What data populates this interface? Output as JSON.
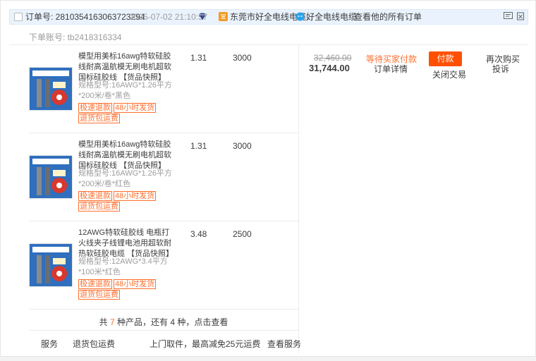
{
  "header": {
    "order_label": "订单号: 2810354163063723294",
    "order_date": "2025-07-02 21:10:57",
    "shop_name": "东莞市好全电线电缆...",
    "wangwang_name": "好全电线电缆",
    "view_all": "查看他的所有订单"
  },
  "sub_account": {
    "label": "下单账号:",
    "value": "tb2418316334"
  },
  "items": [
    {
      "title": "模型用美标16awg特软硅胶线耐高温航模无刷电机超软国标硅胶线 【货品快照】",
      "spec": "规格型号:16AWG*1.26平方*200米/卷*黑色",
      "tags": [
        "极速退款",
        "48小时发货",
        "退货包运费"
      ],
      "price": "1.31",
      "qty": "3000"
    },
    {
      "title": "模型用美标16awg特软硅胶线耐高温航模无刷电机超软国标硅胶线 【货品快照】",
      "spec": "规格型号:16AWG*1.26平方*200米/卷*红色",
      "tags": [
        "极速退款",
        "48小时发货",
        "退货包运费"
      ],
      "price": "1.31",
      "qty": "3000"
    },
    {
      "title": "12AWG特软硅胶线 电瓶打火线夹子线锂电池用超软耐热软硅胶电缆 【货品快照】",
      "spec": "规格型号:12AWG*3.4平方*100米*红色",
      "tags": [
        "极速退款",
        "48小时发货",
        "退货包运费"
      ],
      "price": "3.48",
      "qty": "2500"
    }
  ],
  "more": {
    "prefix": "共 ",
    "count": "7",
    "suffix": " 种产品，还有 4 种，点击查看"
  },
  "footer": {
    "service": "服务",
    "return_freight": "退货包运费",
    "pickup": "上门取件，最高减免25元运费",
    "view_service": "查看服务"
  },
  "summary": {
    "original_price": "32,460.00",
    "total": "31,744.00",
    "status": "等待买家付款",
    "detail": "订单详情",
    "pay": "付款",
    "close": "关闭交易",
    "rebuy": "再次购买",
    "complain": "投诉"
  },
  "colors": {
    "accent": "#ff5000",
    "tag": "#ff6f2e",
    "header_bg": "#eaf3fd"
  }
}
